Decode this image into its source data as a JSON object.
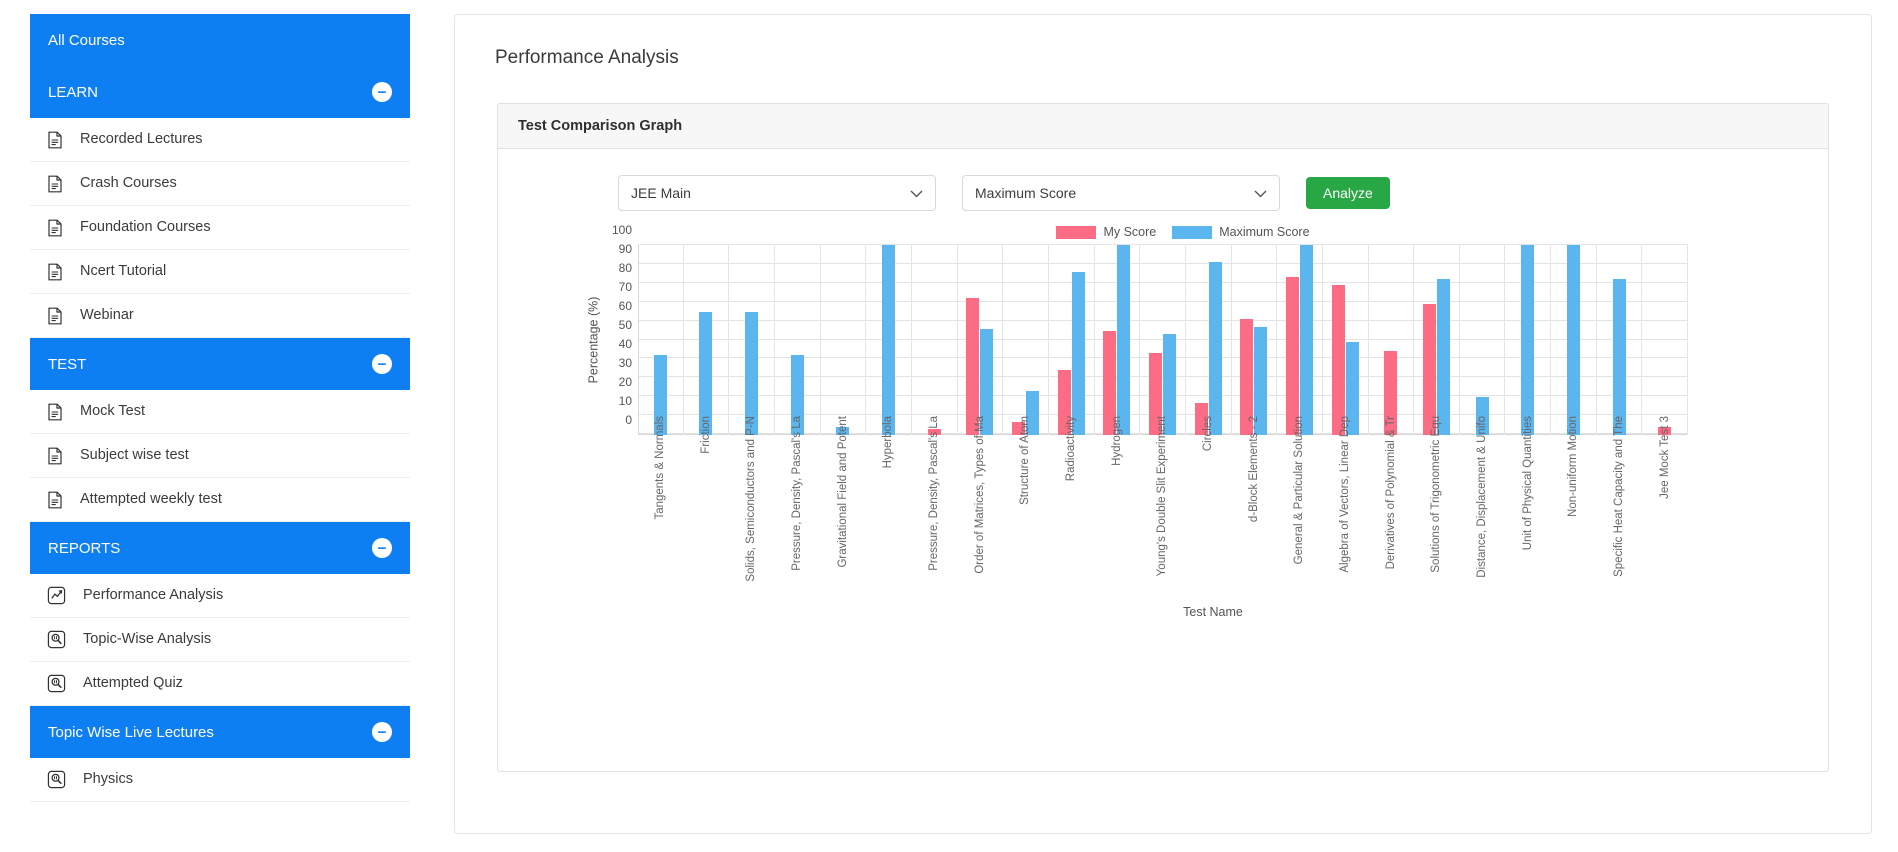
{
  "sidebar": {
    "top_item": {
      "label": "All Courses"
    },
    "sections": [
      {
        "header": "LEARN",
        "collapse": "−",
        "items": [
          {
            "label": "Recorded Lectures",
            "icon": "document-icon"
          },
          {
            "label": "Crash Courses",
            "icon": "document-icon"
          },
          {
            "label": "Foundation Courses",
            "icon": "document-icon"
          },
          {
            "label": "Ncert Tutorial",
            "icon": "document-icon"
          },
          {
            "label": "Webinar",
            "icon": "document-icon"
          }
        ]
      },
      {
        "header": "TEST",
        "collapse": "−",
        "items": [
          {
            "label": "Mock Test",
            "icon": "document-icon"
          },
          {
            "label": "Subject wise test",
            "icon": "document-icon"
          },
          {
            "label": "Attempted weekly test",
            "icon": "document-icon"
          }
        ]
      },
      {
        "header": "REPORTS",
        "collapse": "−",
        "items": [
          {
            "label": "Performance Analysis",
            "icon": "chart-line-icon"
          },
          {
            "label": "Topic-Wise Analysis",
            "icon": "magnifier-icon"
          },
          {
            "label": "Attempted Quiz",
            "icon": "magnifier-icon"
          }
        ]
      },
      {
        "header": "Topic Wise Live Lectures",
        "collapse": "−",
        "items": [
          {
            "label": "Physics",
            "icon": "magnifier-icon"
          }
        ]
      }
    ]
  },
  "main": {
    "page_title": "Performance Analysis",
    "panel_title": "Test Comparison Graph",
    "exam_select": {
      "value": "JEE Main"
    },
    "metric_select": {
      "value": "Maximum Score"
    },
    "analyze_button": "Analyze"
  },
  "colors": {
    "accent_blue": "#0d7ff2",
    "my_score": "#fc6c85",
    "maximum_score": "#5bb5ef",
    "analyze_green": "#28a745"
  },
  "chart_data": {
    "type": "bar",
    "title": "",
    "xlabel": "Test Name",
    "ylabel": "Percentage (%)",
    "ylim": [
      0,
      100
    ],
    "yticks": [
      0,
      10,
      20,
      30,
      40,
      50,
      60,
      70,
      80,
      90,
      100
    ],
    "grid": true,
    "legend_position": "top-center",
    "categories": [
      "Tangents & Normals",
      "Friction",
      "Solids, Semiconductors and P-N",
      "Pressure, Density, Pascal's La",
      "Gravitational Field and Potent",
      "Hyperbola",
      "Pressure, Density, Pascal's La",
      "Order of Matrices, Types of Ma",
      "Structure of Atom",
      "Radioactivity",
      "Hydrogen",
      "Young's Double Slit Experiment",
      "Circles",
      "d-Block Elements - 2",
      "General & Particular Solution",
      "Algebra of Vectors, Linear Dep",
      "Derivatives of Polynomial & Tr",
      "Solutions of Trigonometric Equ",
      "Distance, Displacement & Unifo",
      "Unit of Physical Quantities",
      "Non-uniform Motion",
      "Specific Heat Capacity and The",
      "Jee Mock Test 3"
    ],
    "series": [
      {
        "name": "My Score",
        "color": "#fc6c85",
        "values": [
          0,
          0,
          0,
          0,
          0,
          0,
          3,
          72,
          7,
          34,
          55,
          43,
          17,
          61,
          83,
          79,
          44,
          69,
          0,
          0,
          0,
          0,
          4
        ]
      },
      {
        "name": "Maximum Score",
        "color": "#5bb5ef",
        "values": [
          42,
          65,
          65,
          42,
          4,
          100,
          0,
          56,
          23,
          86,
          100,
          53,
          91,
          57,
          100,
          49,
          0,
          82,
          20,
          100,
          100,
          82,
          0
        ]
      }
    ]
  }
}
